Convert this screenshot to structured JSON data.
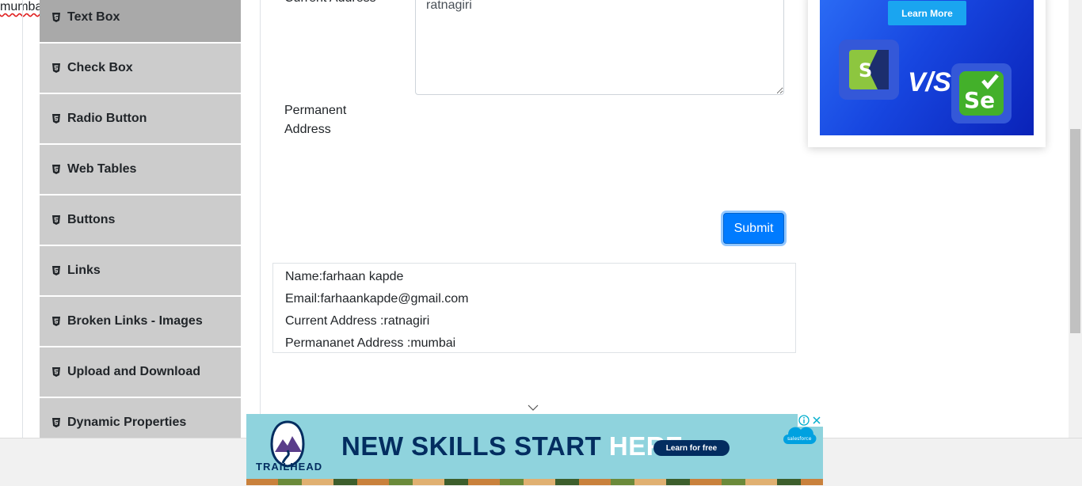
{
  "sidebar": {
    "items": [
      {
        "label": "Text Box",
        "active": true
      },
      {
        "label": "Check Box"
      },
      {
        "label": "Radio Button"
      },
      {
        "label": "Web Tables"
      },
      {
        "label": "Buttons"
      },
      {
        "label": "Links"
      },
      {
        "label": "Broken Links - Images"
      },
      {
        "label": "Upload and Download"
      },
      {
        "label": "Dynamic Properties"
      }
    ],
    "icon": "html5-icon"
  },
  "form": {
    "current_address_label": "Current Address",
    "current_address_value": "ratnagiri",
    "permanent_address_label_line1": "Permanent",
    "permanent_address_label_line2": "Address",
    "permanent_address_value": "mumbai",
    "submit_label": "Submit"
  },
  "output": {
    "name": "Name:farhaan kapde",
    "email": "Email:farhaankapde@gmail.com",
    "current_address": "Current Address :ratnagiri",
    "permanent_address": "Permananet Address :mumbai"
  },
  "side_ad": {
    "button_label": "Learn More",
    "vs_text": "V/S"
  },
  "banner_ad": {
    "brand": "TRAILHEAD",
    "headline_part1": "NEW SKILLS START ",
    "headline_part2": "HERE.",
    "cta_label": "Learn for free",
    "partner": "salesforce"
  },
  "colors": {
    "primary": "#007bff",
    "sidebar_bg": "#cccccc",
    "sidebar_active_bg": "#a9a9a9",
    "banner_bg": "#8fd3dd",
    "banner_text": "#032d60"
  }
}
